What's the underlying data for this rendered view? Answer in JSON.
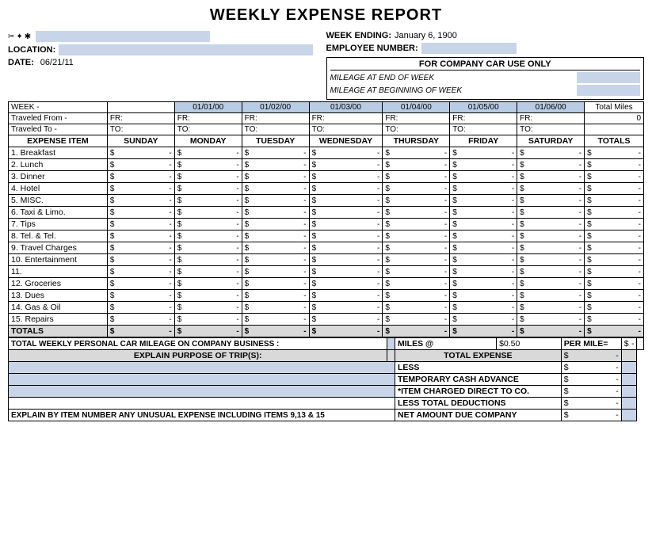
{
  "title": "WEEKLY EXPENSE REPORT",
  "header": {
    "week_ending_label": "WEEK ENDING:",
    "week_ending_value": "January 6, 1900",
    "employee_number_label": "EMPLOYEE NUMBER:",
    "location_label": "LOCATION:",
    "date_label": "DATE:",
    "date_value": "06/21/11",
    "icons": [
      "✂",
      "✦",
      "✱"
    ],
    "company_car_title": "FOR COMPANY CAR USE ONLY",
    "mileage_end": "MILEAGE AT END OF WEEK",
    "mileage_begin": "MILEAGE AT BEGINNING OF WEEK"
  },
  "week_row": {
    "label": "WEEK -",
    "dates": [
      "01/01/00",
      "01/02/00",
      "01/03/00",
      "01/04/00",
      "01/05/00",
      "01/06/00"
    ],
    "total_miles_label": "Total Miles",
    "total_miles_value": "0"
  },
  "traveled_from": {
    "label": "Traveled From -",
    "prefix": "FR:"
  },
  "traveled_to": {
    "label": "Traveled To -",
    "prefix": "TO:"
  },
  "table_headers": {
    "expense_item": "EXPENSE ITEM",
    "sunday": "SUNDAY",
    "monday": "MONDAY",
    "tuesday": "TUESDAY",
    "wednesday": "WEDNESDAY",
    "thursday": "THURSDAY",
    "friday": "FRIDAY",
    "saturday": "SATURDAY",
    "totals": "TOTALS"
  },
  "expense_items": [
    "1. Breakfast",
    "2. Lunch",
    "3. Dinner",
    "4. Hotel",
    "5. MISC.",
    "6. Taxi & Limo.",
    "7. Tips",
    "8. Tel. & Tel.",
    "9. Travel Charges",
    "10. Entertainment",
    "11.",
    "12. Groceries",
    "13. Dues",
    "14. Gas & Oil",
    "15. Repairs",
    "TOTALS"
  ],
  "bottom": {
    "mileage_label": "TOTAL WEEKLY PERSONAL CAR MILEAGE ON COMPANY BUSINESS :",
    "miles_at_label": "MILES @",
    "miles_rate": "$0.50",
    "per_mile_label": "PER MILE=",
    "explain_label": "EXPLAIN PURPOSE OF TRIP(S):",
    "total_expense_label": "TOTAL EXPENSE",
    "less_label": "LESS",
    "temp_advance_label": "TEMPORARY CASH ADVANCE",
    "item_charged_label": "*ITEM CHARGED DIRECT TO CO.",
    "less_deductions_label": "LESS TOTAL DEDUCTIONS",
    "net_amount_label": "NET AMOUNT DUE COMPANY",
    "explain_unusual_label": "EXPLAIN BY ITEM NUMBER ANY UNUSUAL EXPENSE INCLUDING ITEMS 9,13 & 15"
  }
}
